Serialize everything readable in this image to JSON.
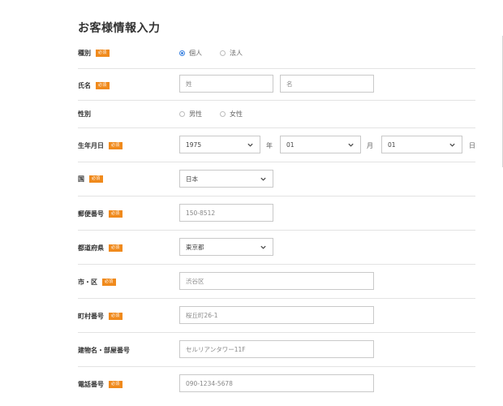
{
  "title": "お客様情報入力",
  "required_label": "必須",
  "rows": {
    "type": {
      "label": "種別",
      "options": [
        "個人",
        "法人"
      ],
      "selected": "個人"
    },
    "name": {
      "label": "氏名",
      "last_placeholder": "姓",
      "first_placeholder": "名"
    },
    "gender": {
      "label": "性別",
      "options": [
        "男性",
        "女性"
      ]
    },
    "birthdate": {
      "label": "生年月日",
      "year": "1975",
      "year_unit": "年",
      "month": "01",
      "month_unit": "月",
      "day": "01",
      "day_unit": "日"
    },
    "country": {
      "label": "国",
      "value": "日本"
    },
    "postal": {
      "label": "郵便番号",
      "placeholder": "150-8512"
    },
    "prefecture": {
      "label": "都道府県",
      "value": "東京都"
    },
    "city": {
      "label": "市・区",
      "placeholder": "渋谷区"
    },
    "town": {
      "label": "町村番号",
      "placeholder": "桜丘町26-1"
    },
    "building": {
      "label": "建物名・部屋番号",
      "placeholder": "セルリアンタワー11F"
    },
    "phone": {
      "label": "電話番号",
      "placeholder": "090-1234-5678"
    }
  },
  "colors": {
    "required_badge": "#f08a1c",
    "radio_selected": "#3b82e0"
  },
  "icons": {
    "select_arrow": "chevron-down-icon"
  }
}
